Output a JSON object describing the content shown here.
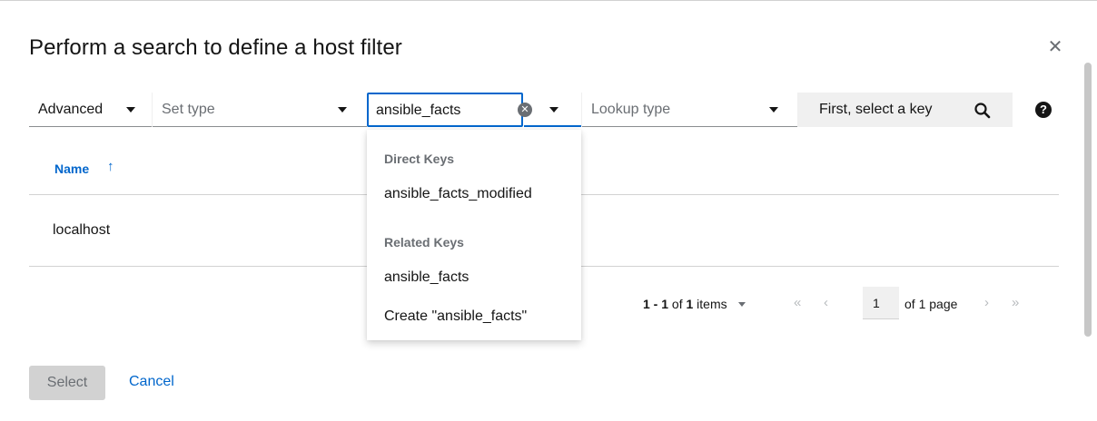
{
  "modal": {
    "title": "Perform a search to define a host filter",
    "close_icon": "close-icon"
  },
  "toolbar": {
    "mode_select": {
      "value": "Advanced"
    },
    "type_select": {
      "placeholder": "Set type"
    },
    "key_input": {
      "value": "ansible_facts"
    },
    "lookup_select": {
      "placeholder": "Lookup type"
    },
    "value_input": {
      "placeholder": "First, select a key"
    },
    "icons": {
      "search": "search-icon",
      "help": "help-icon",
      "clear": "clear-icon"
    }
  },
  "table": {
    "columns": [
      {
        "label": "Name",
        "sort": "ascending"
      }
    ],
    "rows": [
      {
        "name": "localhost"
      }
    ]
  },
  "pagination": {
    "range": "1 - 1",
    "of_text": " of ",
    "total": "1",
    "items_label": " items",
    "first_icon": "«",
    "prev_icon": "‹",
    "page": "1",
    "of_page": "of 1 page",
    "next_icon": "›",
    "last_icon": "»"
  },
  "menu": {
    "groups": [
      {
        "label": "Direct Keys",
        "items": [
          "ansible_facts_modified"
        ]
      },
      {
        "label": "Related Keys",
        "items": [
          "ansible_facts"
        ]
      }
    ],
    "create_option": "Create \"ansible_facts\""
  },
  "footer": {
    "select_label": "Select",
    "cancel_label": "Cancel"
  },
  "colors": {
    "accent": "#0066cc",
    "disabled_bg": "#d2d2d2",
    "muted_text": "#6a6e73"
  }
}
